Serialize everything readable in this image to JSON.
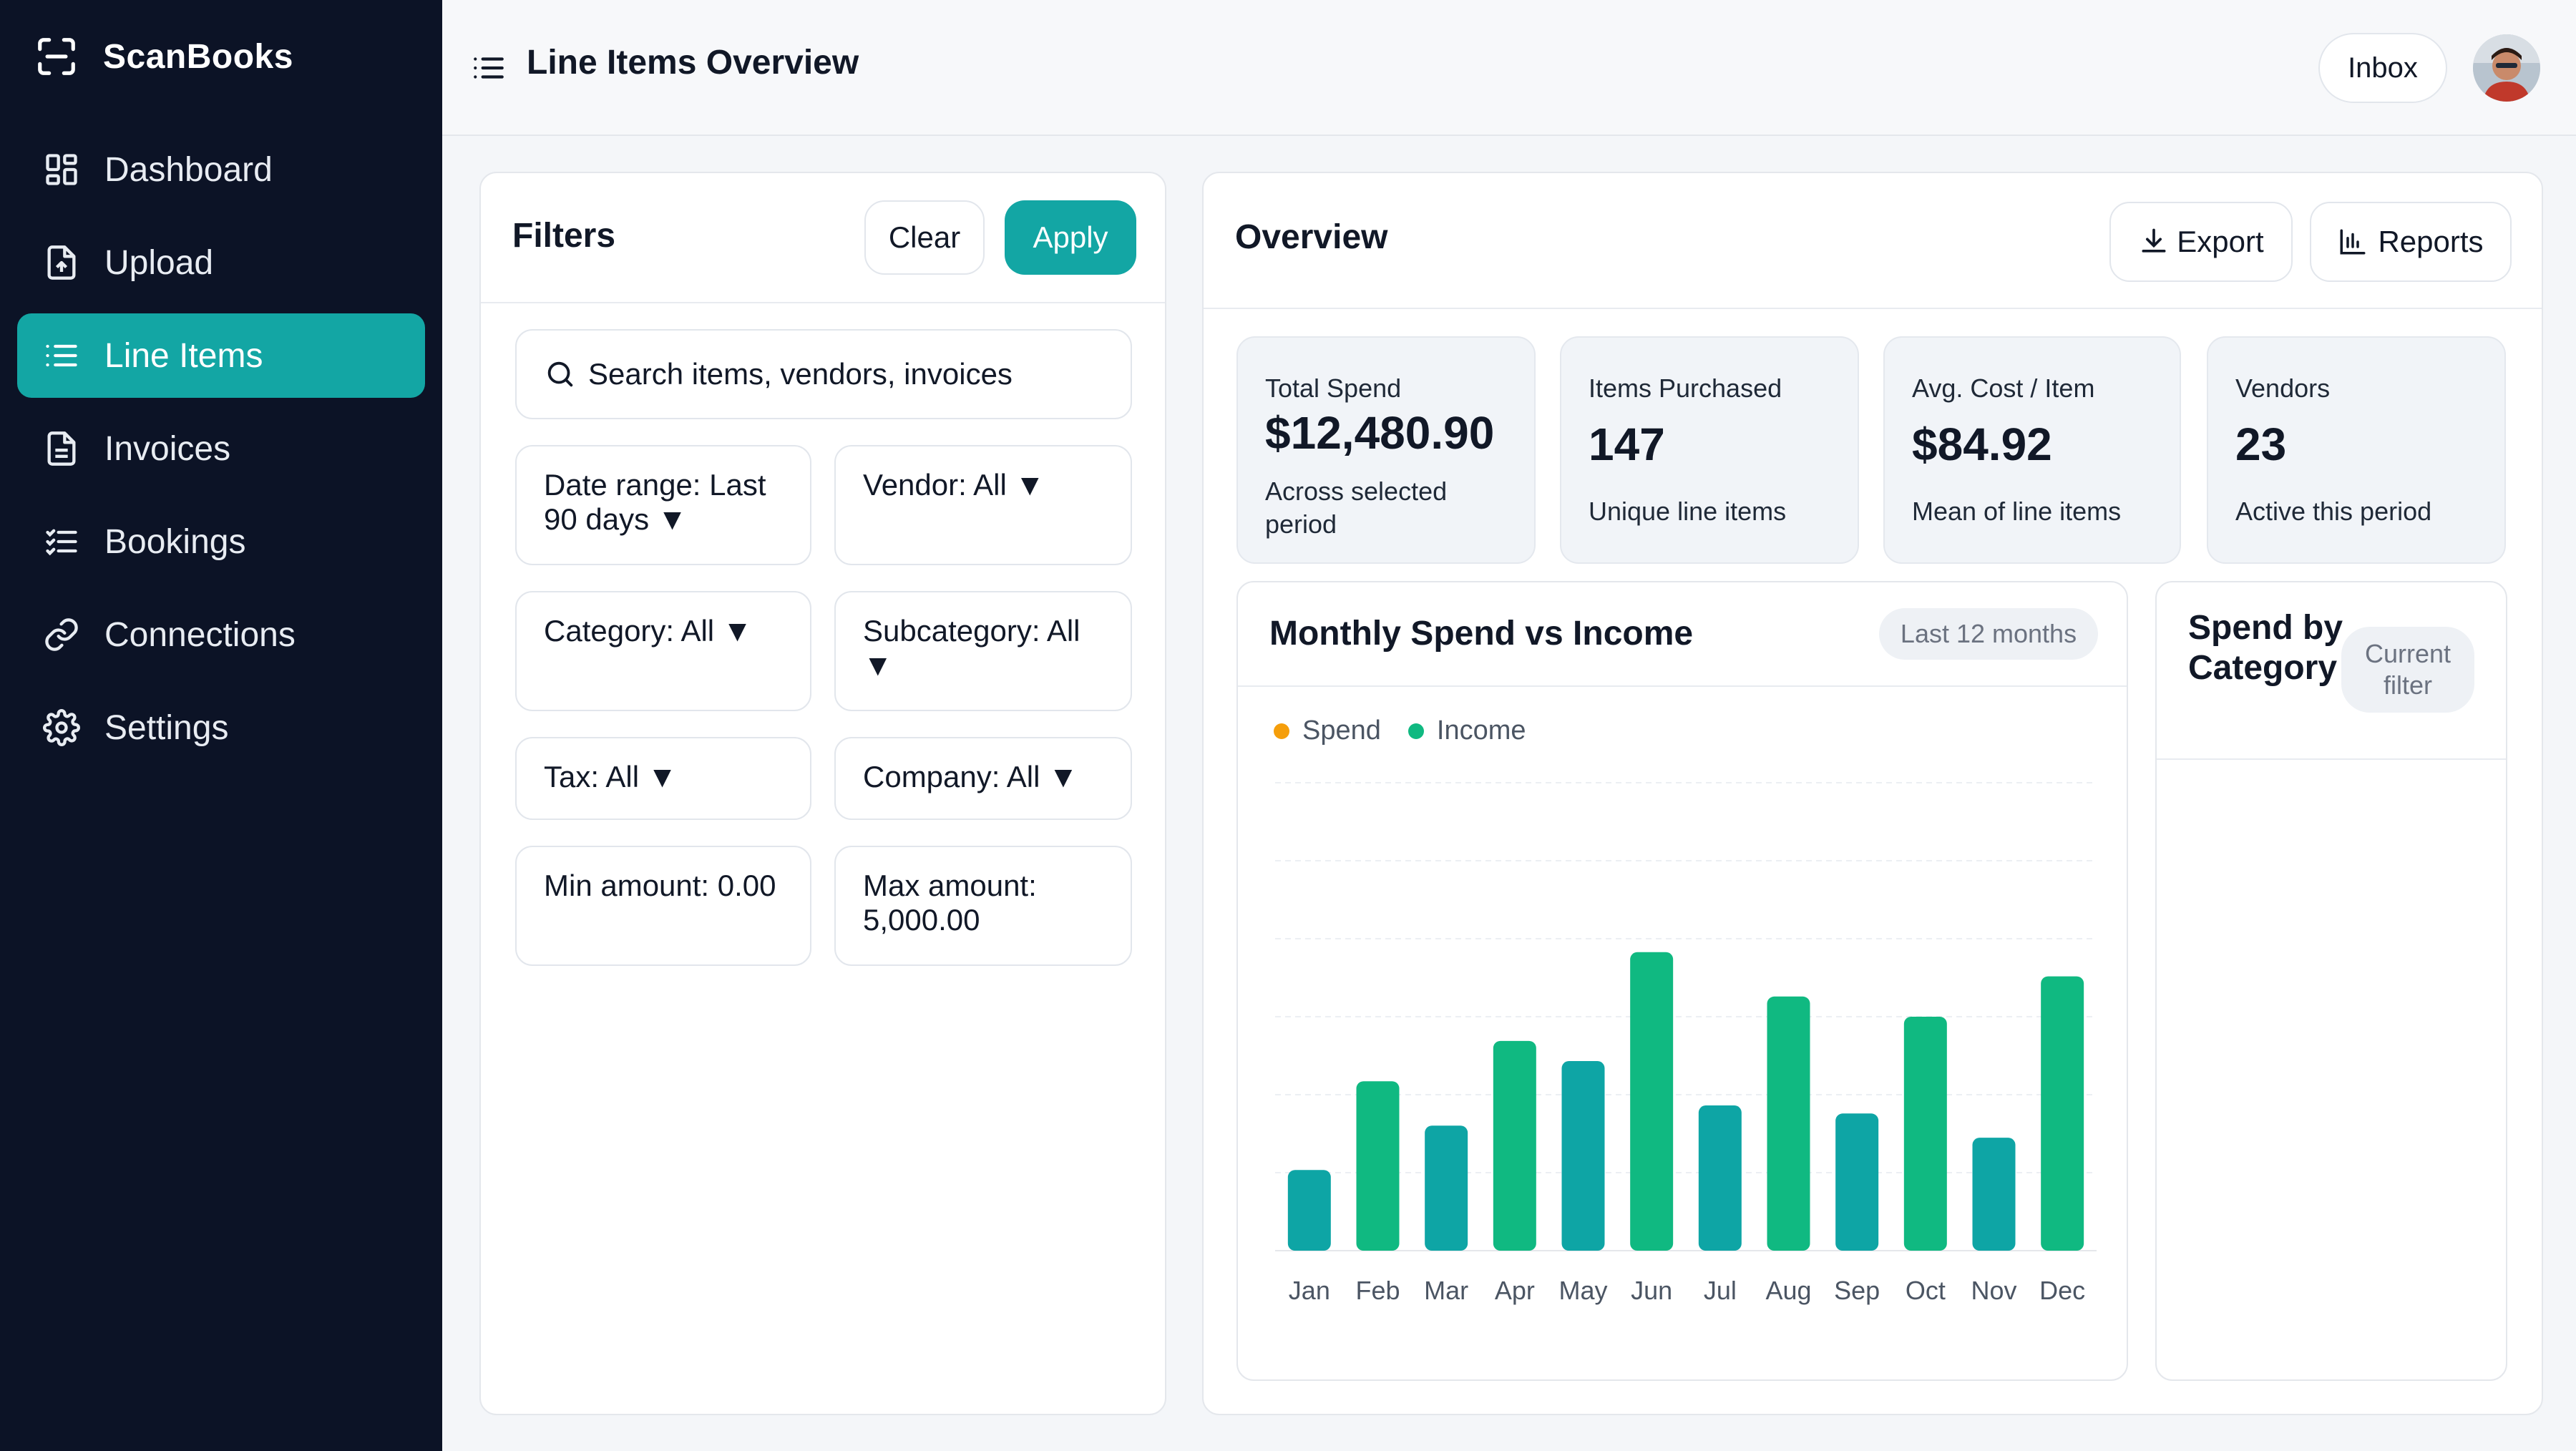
{
  "app": {
    "name": "ScanBooks"
  },
  "sidebar": {
    "items": [
      {
        "label": "Dashboard",
        "icon": "dashboard-icon"
      },
      {
        "label": "Upload",
        "icon": "upload-icon"
      },
      {
        "label": "Line Items",
        "icon": "list-icon",
        "active": true
      },
      {
        "label": "Invoices",
        "icon": "invoice-icon"
      },
      {
        "label": "Bookings",
        "icon": "bookings-icon"
      },
      {
        "label": "Connections",
        "icon": "link-icon"
      },
      {
        "label": "Settings",
        "icon": "gear-icon"
      }
    ]
  },
  "header": {
    "title": "Line Items Overview",
    "inbox_label": "Inbox"
  },
  "filters": {
    "title": "Filters",
    "clear_label": "Clear",
    "apply_label": "Apply",
    "search_placeholder": "Search items, vendors, invoices",
    "date_range": "Date range: Last 90 days ▼",
    "vendor": "Vendor: All ▼",
    "category": "Category: All ▼",
    "subcategory": "Subcategory: All ▼",
    "tax": "Tax: All ▼",
    "company": "Company: All ▼",
    "min_amount": "Min amount: 0.00",
    "max_amount": "Max amount: 5,000.00"
  },
  "overview": {
    "title": "Overview",
    "export_label": "Export",
    "reports_label": "Reports",
    "kpis": [
      {
        "label": "Total Spend",
        "value": "$12,480.90",
        "sub": "Across selected period"
      },
      {
        "label": "Items Purchased",
        "value": "147",
        "sub": "Unique line items"
      },
      {
        "label": "Avg. Cost / Item",
        "value": "$84.92",
        "sub": "Mean of line items"
      },
      {
        "label": "Vendors",
        "value": "23",
        "sub": "Active this period"
      }
    ]
  },
  "monthly_chart": {
    "title": "Monthly Spend vs Income",
    "period": "Last 12 months",
    "legend": {
      "spend": "Spend",
      "income": "Income"
    }
  },
  "category_panel": {
    "title": "Spend by Category",
    "badge": "Current filter"
  },
  "colors": {
    "accent": "#13a6a4",
    "spend_legend": "#f59e0b",
    "income": "#10b981",
    "teal_bar": "#0ea5a5",
    "sidebar": "#0c1326"
  },
  "chart_data": {
    "type": "bar",
    "title": "Monthly Spend vs Income",
    "categories": [
      "Jan",
      "Feb",
      "Mar",
      "Apr",
      "May",
      "Jun",
      "Jul",
      "Aug",
      "Sep",
      "Oct",
      "Nov",
      "Dec"
    ],
    "values": [
      20,
      42,
      31,
      52,
      47,
      74,
      36,
      63,
      34,
      58,
      28,
      68
    ],
    "bar_colors": [
      "#0ea5a5",
      "#10b981",
      "#0ea5a5",
      "#10b981",
      "#0ea5a5",
      "#10b981",
      "#0ea5a5",
      "#10b981",
      "#0ea5a5",
      "#10b981",
      "#0ea5a5",
      "#10b981"
    ],
    "ylim": [
      0,
      116
    ],
    "grid": true,
    "legend_position": "top-left"
  }
}
